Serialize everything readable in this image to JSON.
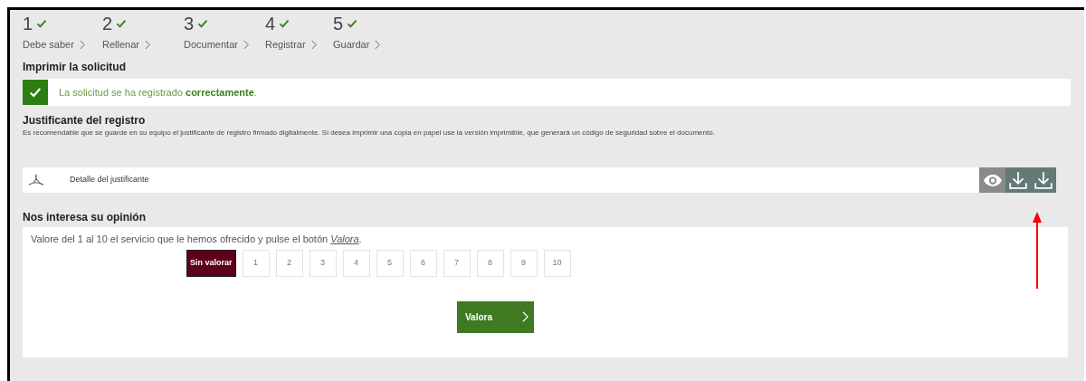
{
  "steps": [
    {
      "number": "1",
      "label": "Debe saber",
      "done": true
    },
    {
      "number": "2",
      "label": "Rellenar",
      "done": true
    },
    {
      "number": "3",
      "label": "Documentar",
      "done": true
    },
    {
      "number": "4",
      "label": "Registrar",
      "done": true
    },
    {
      "number": "5",
      "label": "Guardar",
      "done": true
    }
  ],
  "print_section": {
    "heading": "Imprimir la solicitud",
    "success_message": "La solicitud se ha registrado **correctamente**."
  },
  "receipt_section": {
    "heading": "Justificante del registro",
    "description": "Es recomendable que se guarde en su equipo el justificante de registro firmado digitalmente. Si desea imprimir una copia en papel use la versión imprimible, que generará un código de seguridad sobre el documento.",
    "file": {
      "name": "Detalle del justificante"
    }
  },
  "opinion_section": {
    "heading": "Nos interesa su opinión",
    "instruction": "Valore del 1 al 10 el servicio que le hemos ofrecido y pulse el botón ",
    "instruction_link": "Valora",
    "instruction_end": ".",
    "ratings": [
      {
        "label": "Sin valorar",
        "selected": true
      },
      {
        "label": "1",
        "selected": false
      },
      {
        "label": "2",
        "selected": false
      },
      {
        "label": "3",
        "selected": false
      },
      {
        "label": "4",
        "selected": false
      },
      {
        "label": "5",
        "selected": false
      },
      {
        "label": "6",
        "selected": false
      },
      {
        "label": "7",
        "selected": false
      },
      {
        "label": "8",
        "selected": false
      },
      {
        "label": "9",
        "selected": false
      },
      {
        "label": "10",
        "selected": false
      }
    ],
    "submit_button": "Valora"
  },
  "annotation": {
    "kind": "arrow"
  }
}
